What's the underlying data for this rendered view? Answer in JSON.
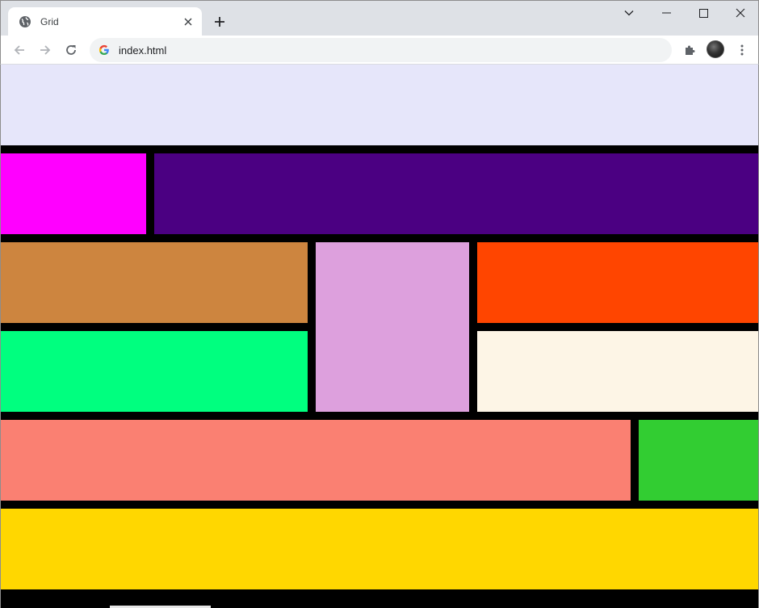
{
  "tab": {
    "title": "Grid",
    "favicon": "globe-icon",
    "close_icon": "close-icon"
  },
  "new_tab_icon": "plus-icon",
  "window": {
    "controls": [
      "chevron-down-icon",
      "minimize-icon",
      "maximize-icon",
      "close-icon"
    ]
  },
  "toolbar": {
    "back_icon": "back-arrow-icon",
    "forward_icon": "forward-arrow-icon",
    "reload_icon": "reload-icon",
    "url": "index.html",
    "extensions_icon": "puzzle-icon",
    "menu_icon": "kebab-menu-icon"
  },
  "grid": {
    "background": "#000000",
    "cells": [
      {
        "name": "header-block",
        "color": "#e6e6fa"
      },
      {
        "name": "sidebar-block",
        "color": "#ff00ff"
      },
      {
        "name": "main-block",
        "color": "#4b0082"
      },
      {
        "name": "cell-a-block",
        "color": "#cd853f"
      },
      {
        "name": "tall-center-block",
        "color": "#dda0dd"
      },
      {
        "name": "cell-c-block",
        "color": "#ff4500"
      },
      {
        "name": "cell-b-block",
        "color": "#00ff7f"
      },
      {
        "name": "cell-d-block",
        "color": "#fdf5e6"
      },
      {
        "name": "cell-e-block",
        "color": "#fa8072"
      },
      {
        "name": "cell-f-block",
        "color": "#32cd32"
      },
      {
        "name": "footer-block",
        "color": "#ffd700"
      }
    ]
  }
}
